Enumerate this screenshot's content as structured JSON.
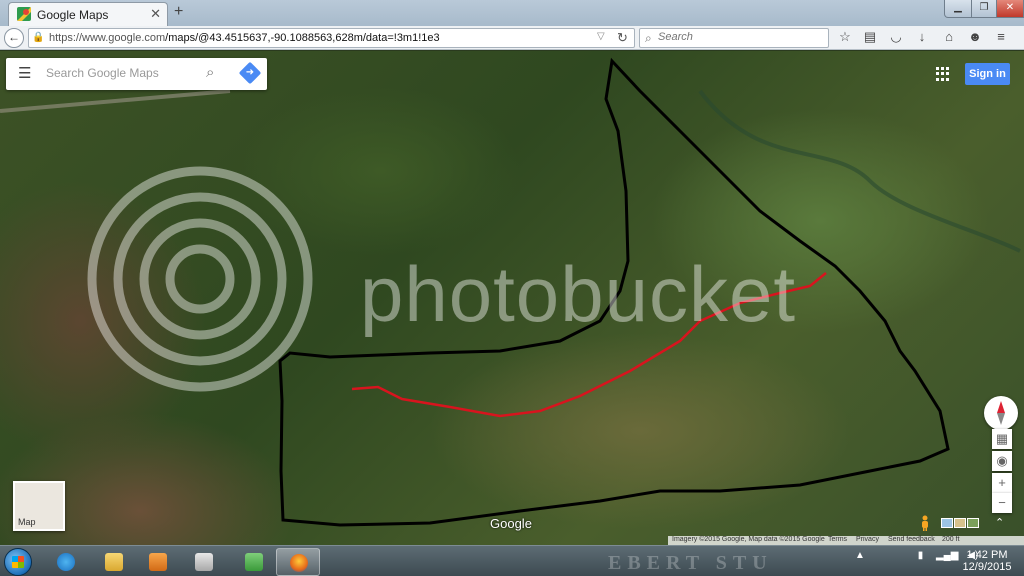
{
  "browser": {
    "tab_title": "Google Maps",
    "url_host": "https://www.google.com",
    "url_path": "/maps/@43.4515637,-90.1088563,628m/data=!3m1!1e3",
    "search_placeholder": "Search"
  },
  "maps": {
    "search_placeholder": "Search Google Maps",
    "signin_label": "Sign in",
    "toggle_label": "Map",
    "logo": "Google",
    "footer": {
      "imagery": "Imagery ©2015 Google, Map data ©2015 Google",
      "terms": "Terms",
      "privacy": "Privacy",
      "feedback": "Send feedback",
      "scale": "200 ft"
    },
    "overlay_colors": {
      "boundary": "#000000",
      "trail": "#d8141e"
    }
  },
  "watermark": "photobucket",
  "taskbar": {
    "time": "1:42 PM",
    "date": "12/9/2015",
    "overlay_text": "EBERT STU"
  }
}
